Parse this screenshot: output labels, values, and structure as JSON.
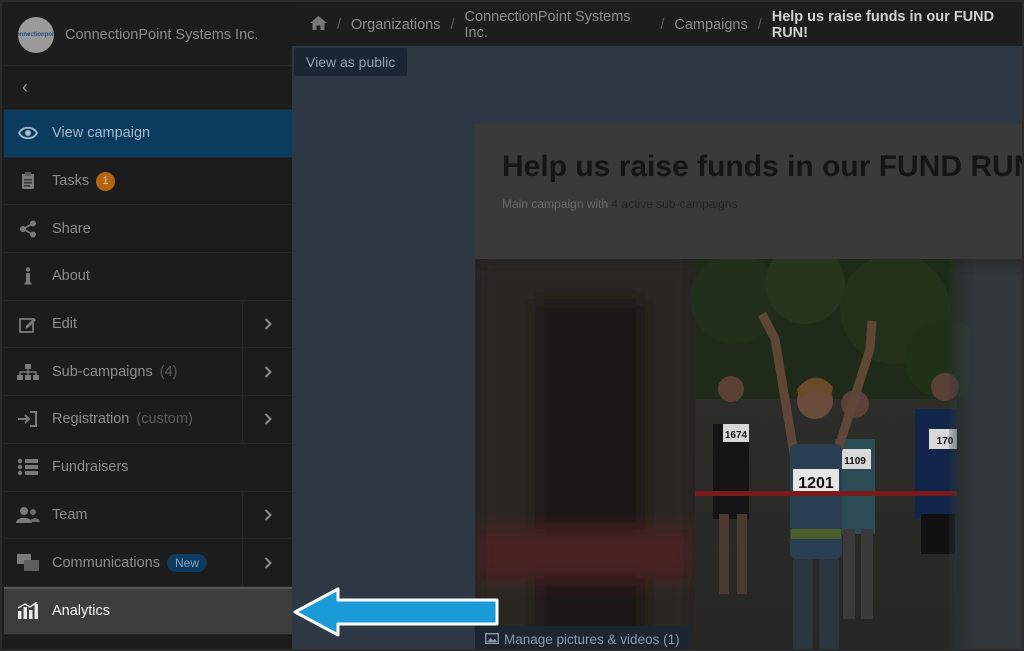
{
  "org": {
    "name": "ConnectionPoint Systems Inc.",
    "logo_text": "connectionpoint"
  },
  "breadcrumb": {
    "items": [
      "Organizations",
      "ConnectionPoint Systems Inc.",
      "Campaigns"
    ],
    "current": "Help us raise funds in our FUND RUN!",
    "home_icon": "home-icon"
  },
  "sidebar": {
    "back_symbol": "‹",
    "items": [
      {
        "label": "View campaign",
        "icon": "eye-icon"
      },
      {
        "label": "Tasks",
        "icon": "clipboard-icon",
        "badge": "1"
      },
      {
        "label": "Share",
        "icon": "share-icon"
      },
      {
        "label": "About",
        "icon": "info-icon"
      },
      {
        "label": "Edit",
        "icon": "edit-icon"
      },
      {
        "label": "Sub-campaigns",
        "icon": "hierarchy-icon",
        "extra": "(4)"
      },
      {
        "label": "Registration",
        "icon": "sign-in-icon",
        "extra": "(custom)"
      },
      {
        "label": "Fundraisers",
        "icon": "list-icon"
      },
      {
        "label": "Team",
        "icon": "users-icon"
      },
      {
        "label": "Communications",
        "icon": "messages-icon",
        "badge": "New"
      },
      {
        "label": "Analytics",
        "icon": "bar-chart-icon"
      }
    ]
  },
  "main": {
    "view_public_label": "View as public",
    "campaign_title": "Help us raise funds in our FUND RUN!",
    "sub_prefix": "Main campaign with",
    "sub_strong": "4 active sub-campaigns",
    "manage_label": "Manage pictures & videos (1)",
    "bib_numbers": [
      "1201",
      "1109",
      "1674",
      "170"
    ]
  },
  "colors": {
    "active_item": "#0c3b60",
    "highlight_item": "#3d3d3d",
    "arrow": "#1a9ad6",
    "task_badge": "#b4650f"
  }
}
